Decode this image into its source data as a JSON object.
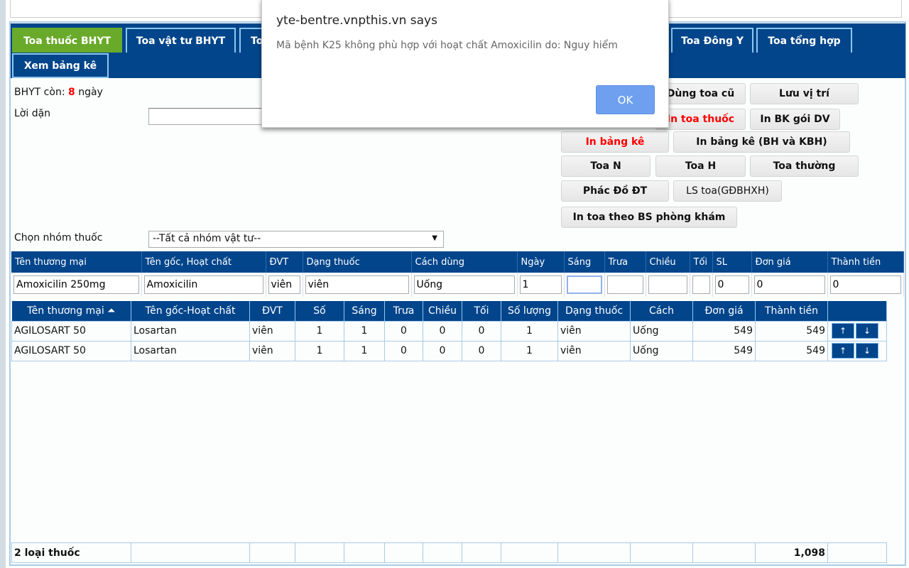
{
  "tabs": [
    "Toa thuốc BHYT",
    "Toa vật tư BHYT",
    "To",
    "Toa Đông Y",
    "Toa tổng hợp",
    "Xem bảng kê"
  ],
  "bhyt": {
    "prefix": "BHYT còn:",
    "days": "8",
    "suffix": "ngày"
  },
  "loi_dan": {
    "label": "Lời dặn",
    "value": ""
  },
  "buttons": {
    "dung_toa_cu": "Dùng toa cũ",
    "luu_vi_tri": "Lưu vị trí",
    "in_toa_thuoc": "In toa thuốc",
    "in_bk_goi_dv": "In BK gói DV",
    "in_bang_ke": "In bảng kê",
    "in_bang_ke_bh": "In bảng kê (BH và KBH)",
    "toa_n": "Toa N",
    "toa_h": "Toa H",
    "toa_thuong": "Toa thường",
    "phac_do": "Phác Đồ ĐT",
    "ls_toa": "LS toa(GĐBHXH)",
    "in_toa_bs": "In toa theo BS phòng khám"
  },
  "nhom": {
    "label": "Chọn nhóm thuốc",
    "selected": "--Tất cả nhóm vật tư--"
  },
  "entry": {
    "headers": [
      "Tên thương mại",
      "Tên gốc, Hoạt chất",
      "ĐVT",
      "Dạng thuốc",
      "Cách dùng",
      "Ngày",
      "Sáng",
      "Trưa",
      "Chiều",
      "Tối",
      "SL",
      "Đơn giá",
      "Thành tiền"
    ],
    "values": [
      "Amoxicilin 250mg",
      "Amoxicilin",
      "viên",
      "viên",
      "Uống",
      "1",
      "",
      "",
      "",
      "",
      "0",
      "0",
      "0"
    ]
  },
  "list": {
    "headers": [
      "Tên thương mại ⏶",
      "Tên gốc-Hoạt chất",
      "ĐVT",
      "Số",
      "Sáng",
      "Trưa",
      "Chiều",
      "Tối",
      "Số lượng",
      "Dạng thuốc",
      "Cách",
      "Đơn giá",
      "Thành tiền",
      ""
    ],
    "rows": [
      [
        "AGILOSART 50",
        "Losartan",
        "viên",
        "1",
        "1",
        "0",
        "0",
        "0",
        "1",
        "viên",
        "Uống",
        "549",
        "549"
      ],
      [
        "AGILOSART 50",
        "Losartan",
        "viên",
        "1",
        "1",
        "0",
        "0",
        "0",
        "1",
        "viên",
        "Uống",
        "549",
        "549"
      ]
    ],
    "up": "↑",
    "down": "↓"
  },
  "footer": {
    "count": "2 loại thuốc",
    "total": "1,098"
  },
  "dialog": {
    "title": "yte-bentre.vnpthis.vn says",
    "message": "Mã bệnh K25 không phù hợp với hoạt chất Amoxicilin do: Nguy hiểm",
    "ok": "OK"
  }
}
